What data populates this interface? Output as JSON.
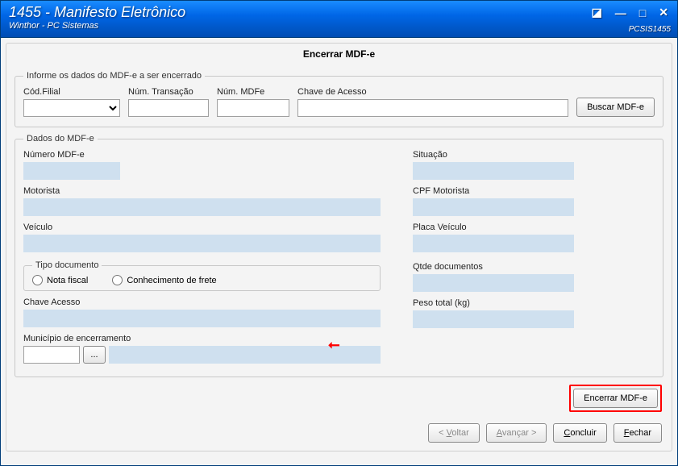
{
  "window": {
    "title": "1455 - Manifesto Eletrônico",
    "subtitle": "Winthor - PC Sistemas",
    "code": "PCSIS1455"
  },
  "section": {
    "title": "Encerrar MDF-e"
  },
  "search_group": {
    "legend": "Informe os dados do MDF-e a ser encerrado",
    "cod_filial_label": "Cód.Filial",
    "num_transacao_label": "Núm. Transação",
    "num_mdfe_label": "Núm. MDFe",
    "chave_acesso_label": "Chave de Acesso",
    "buscar_btn": "Buscar MDF-e"
  },
  "dados_group": {
    "legend": "Dados do MDF-e",
    "numero_label": "Número MDF-e",
    "situacao_label": "Situação",
    "motorista_label": "Motorista",
    "cpf_motorista_label": "CPF Motorista",
    "veiculo_label": "Veículo",
    "placa_label": "Placa Veículo",
    "qtde_docs_label": "Qtde documentos",
    "chave_acesso_label": "Chave Acesso",
    "peso_total_label": "Peso total (kg)",
    "tipo_doc": {
      "legend": "Tipo documento",
      "nota_fiscal": "Nota fiscal",
      "conhecimento": "Conhecimento de frete"
    },
    "municipio_label": "Município de encerramento",
    "lookup_btn": "..."
  },
  "actions": {
    "encerrar_btn": "Encerrar MDF-e",
    "voltar_prefix": "< ",
    "voltar_u": "V",
    "voltar_suffix": "oltar",
    "avancar_u": "A",
    "avancar_suffix": "vançar >",
    "concluir_u": "C",
    "concluir_suffix": "oncluir",
    "fechar_u": "F",
    "fechar_suffix": "echar"
  },
  "values": {
    "cod_filial": "",
    "num_transacao": "",
    "num_mdfe": "",
    "chave_acesso_busca": "",
    "numero_mdfe": "",
    "situacao": "",
    "motorista": "",
    "cpf_motorista": "",
    "veiculo": "",
    "placa": "",
    "qtde_docs": "",
    "chave_acesso": "",
    "peso_total": "",
    "municipio_cod": "",
    "municipio_nome": ""
  }
}
